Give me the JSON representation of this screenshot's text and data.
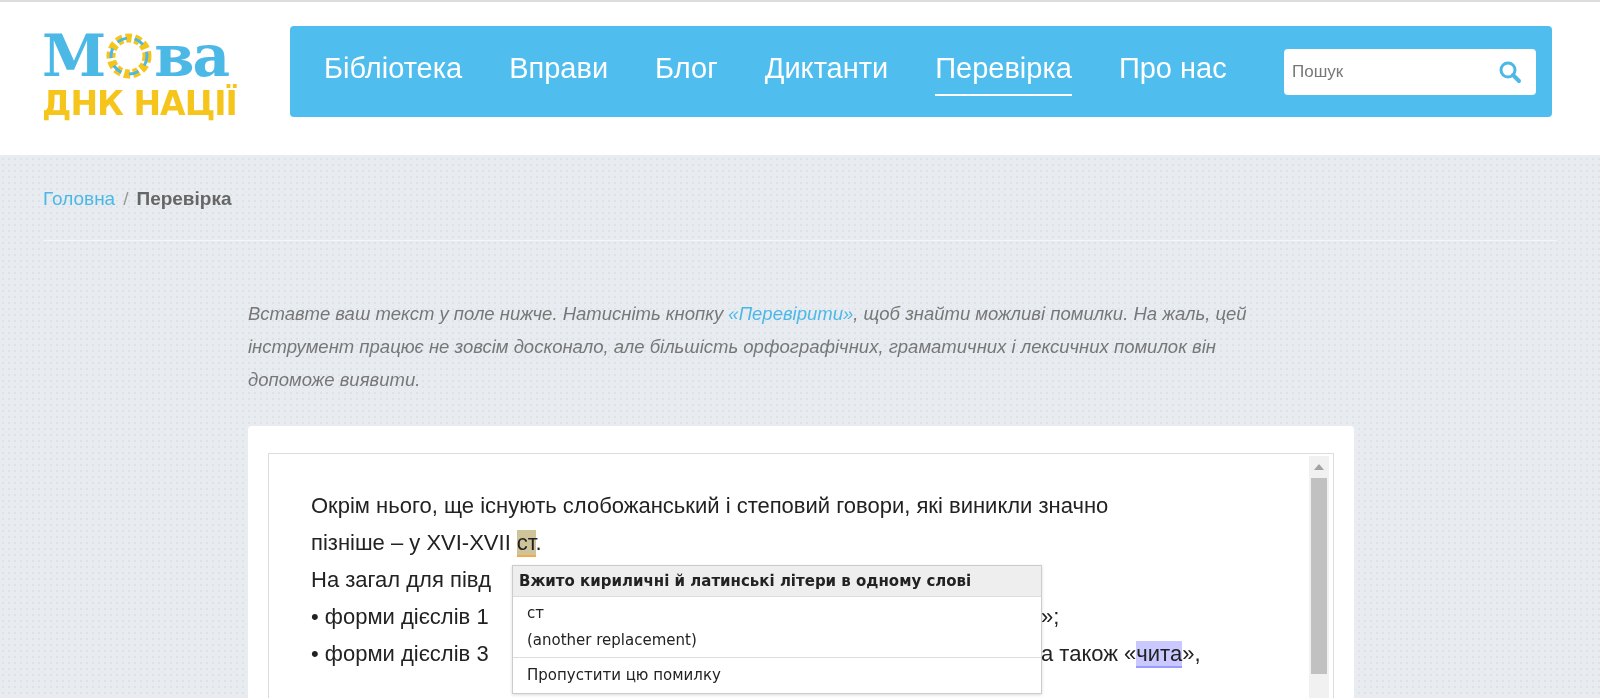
{
  "logo": {
    "before_ring": "М",
    "after_ring": "ва",
    "subtitle": "ДНК НАЦІЇ"
  },
  "nav": [
    {
      "label": "Бібліотека",
      "selected": false
    },
    {
      "label": "Вправи",
      "selected": false
    },
    {
      "label": "Блог",
      "selected": false
    },
    {
      "label": "Диктанти",
      "selected": false
    },
    {
      "label": "Перевірка",
      "selected": true
    },
    {
      "label": "Про нас",
      "selected": false
    }
  ],
  "search": {
    "placeholder": "Пошук"
  },
  "breadcrumb": {
    "separator": "/",
    "items": [
      {
        "label": "Головна",
        "selected": false
      },
      {
        "label": "Перевірка",
        "selected": true
      }
    ]
  },
  "intro": {
    "before": "Вставте ваш текст у поле нижче. Натисніть кнопку ",
    "link": "«Перевірити»",
    "after": ", щоб знайти можливі помилки. На жаль, цей інструмент працює не зовсім досконало, але більшість орфографічних, граматичних і лексичних помилок він допоможе виявити."
  },
  "editor": {
    "lines": [
      {
        "left": [
          {
            "text": "Окрім нього, ще існують слобожанський і степовий говори, які виникли значно",
            "kind": "plain"
          }
        ]
      },
      {
        "left": [
          {
            "text": "пізніше – у XVI-XVII ",
            "kind": "plain"
          },
          {
            "text": "ст",
            "kind": "error"
          },
          {
            "text": ".",
            "kind": "plain"
          }
        ]
      },
      {
        "left": [
          {
            "text": "На загал для півд",
            "kind": "plain"
          }
        ]
      },
      {
        "left": [
          {
            "text": "• форми дієслів 1",
            "kind": "plain"
          }
        ],
        "right": [
          {
            "text": "»;",
            "kind": "plain"
          }
        ]
      },
      {
        "left": [
          {
            "text": "• форми дієслів 3",
            "kind": "plain"
          }
        ],
        "right": [
          {
            "text": "а також «",
            "kind": "plain"
          },
          {
            "text": "чита",
            "kind": "style"
          },
          {
            "text": "»,",
            "kind": "plain"
          }
        ]
      }
    ]
  },
  "popup": {
    "title": "Вжито кириличні й латинські літери в одному слові",
    "suggestions": [
      "ст",
      "(another replacement)"
    ],
    "action": "Пропустити цю помилку"
  }
}
